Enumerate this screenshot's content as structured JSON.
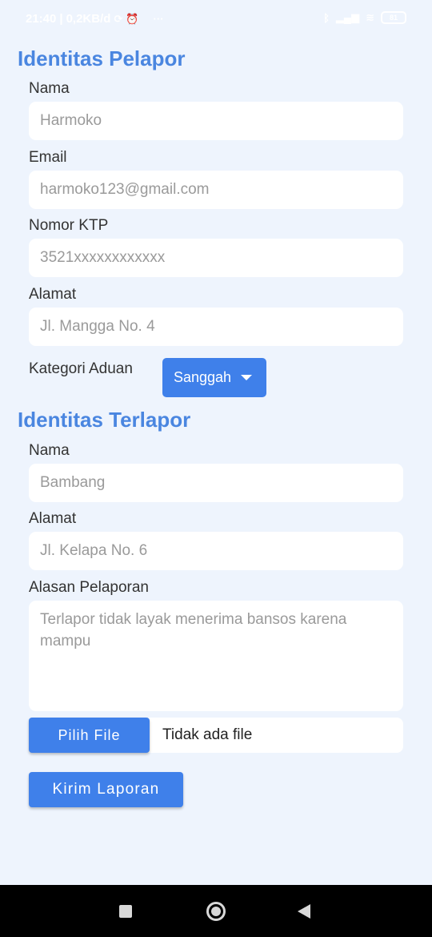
{
  "status_bar": {
    "time": "21:40",
    "net_speed": "0,2KB/d",
    "dots": "···",
    "battery": "81"
  },
  "pelapor": {
    "title": "Identitas Pelapor",
    "nama_label": "Nama",
    "nama_value": "Harmoko",
    "email_label": "Email",
    "email_value": "harmoko123@gmail.com",
    "ktp_label": "Nomor KTP",
    "ktp_value": "3521xxxxxxxxxxxx",
    "alamat_label": "Alamat",
    "alamat_value": "Jl. Mangga No. 4",
    "kategori_label": "Kategori Aduan",
    "kategori_value": "Sanggah"
  },
  "terlapor": {
    "title": "Identitas Terlapor",
    "nama_label": "Nama",
    "nama_value": "Bambang",
    "alamat_label": "Alamat",
    "alamat_value": "Jl. Kelapa No. 6",
    "alasan_label": "Alasan Pelaporan",
    "alasan_value": "Terlapor tidak layak menerima bansos karena mampu"
  },
  "file": {
    "button_label": "Pilih File",
    "status": "Tidak ada file"
  },
  "submit_label": "Kirim Laporan",
  "colors": {
    "accent": "#3f80ea",
    "title": "#4a86e0",
    "background": "#eef4fd"
  }
}
